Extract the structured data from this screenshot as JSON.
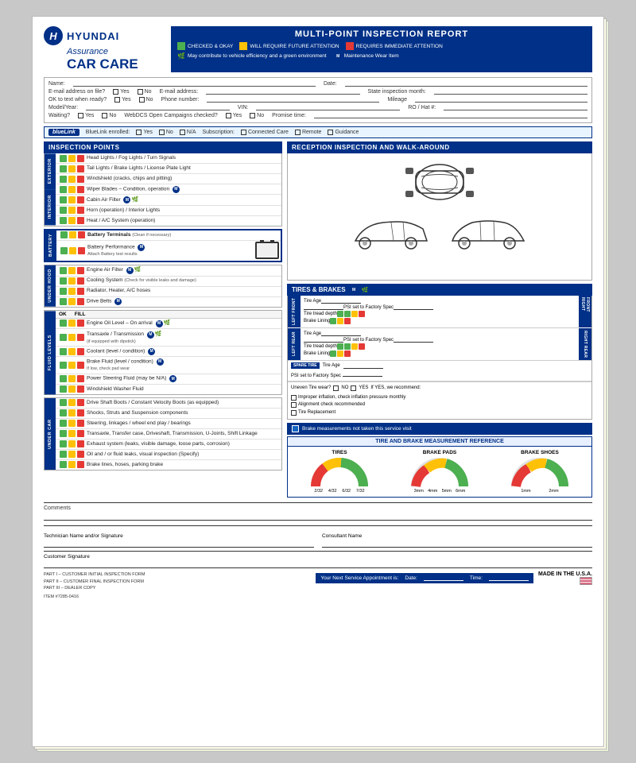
{
  "header": {
    "brand": "HYUNDAI",
    "brand_sub": "Assurance",
    "car_care": "CAR CARE",
    "report_title": "MULTI-POINT INSPECTION REPORT",
    "legend": {
      "checked": "CHECKED & OKAY",
      "will_require": "WILL REQUIRE FUTURE ATTENTION",
      "requires_immediate": "REQUIRES IMMEDIATE ATTENTION",
      "leaf_note": "May contribute to vehicle efficiency and a green environment",
      "mw_note": "Maintenance Wear Item"
    }
  },
  "form_fields": {
    "name_label": "Name:",
    "email_file_label": "E-mail address on file?",
    "ok_text_label": "OK to text when ready?",
    "model_year_label": "Model/Year:",
    "waiting_label": "Waiting?",
    "email_addr_label": "E-mail address:",
    "phone_label": "Phone number:",
    "vin_label": "VIN:",
    "webdcs_label": "WebDCS Open Campaigns checked?",
    "date_label": "Date:",
    "state_insp_label": "State inspection month:",
    "mileage_label": "Mileage",
    "ro_hat_label": "RO / Hat #:",
    "promise_label": "Promise time:"
  },
  "bluelink": {
    "label": "BlueLink",
    "enrolled_label": "BlueLink enrolled:",
    "subscription_label": "Subscription:",
    "connected_care": "Connected Care",
    "remote": "Remote",
    "guidance": "Guidance"
  },
  "inspection": {
    "section_title": "INSPECTION POINTS",
    "groups": {
      "exterior": {
        "label": "EXTERIOR",
        "items": [
          {
            "text": "Head Lights / Fog Lights / Turn Signals",
            "dots": [
              "g",
              "y",
              "r"
            ]
          },
          {
            "text": "Tail Lights / Brake Lights / License Plate Light",
            "dots": [
              "g",
              "y",
              "r"
            ]
          },
          {
            "text": "Windshield (cracks, chips and pitting)",
            "dots": [
              "g",
              "y",
              "r"
            ]
          },
          {
            "text": "Wiper Blades – Condition, operation",
            "dots": [
              "g",
              "y",
              "r"
            ],
            "mw": true
          }
        ]
      },
      "interior": {
        "label": "INTERIOR",
        "items": [
          {
            "text": "Cabin Air Filter",
            "dots": [
              "g",
              "y",
              "r"
            ],
            "leaf": true,
            "mw": true
          },
          {
            "text": "Horn (operation) / Interior Lights",
            "dots": [
              "g",
              "y",
              "r"
            ]
          },
          {
            "text": "Heat / A/C System (operation)",
            "dots": [
              "g",
              "y",
              "r"
            ]
          }
        ]
      },
      "battery": {
        "label": "BATTERY",
        "items": [
          {
            "text": "Battery Terminals",
            "sub": "(Clean if necessary)",
            "dots": [
              "g",
              "y",
              "r"
            ]
          },
          {
            "text": "Battery Performance",
            "dots": [
              "g",
              "y",
              "r"
            ],
            "mw": true,
            "sub": "Attach Battery test results"
          }
        ]
      },
      "under_hood": {
        "label": "UNDER HOOD",
        "items": [
          {
            "text": "Engine Air Filter",
            "dots": [
              "g",
              "y",
              "r"
            ],
            "mw": true,
            "leaf": true
          },
          {
            "text": "Cooling System",
            "sub": "(Check for visible leaks and damage)",
            "dots": [
              "g",
              "y",
              "r"
            ]
          },
          {
            "text": "Radiator, Heater, A/C hoses",
            "dots": [
              "g",
              "y",
              "r"
            ]
          },
          {
            "text": "Drive Belts",
            "dots": [
              "g",
              "y",
              "r"
            ],
            "mw": true
          }
        ]
      },
      "fluid_levels": {
        "label": "FLUID LEVELS",
        "ok_fill": true,
        "items": [
          {
            "text": "Engine Oil Level – On arrival",
            "dots": [
              "g",
              "y",
              "r"
            ],
            "mw": true,
            "leaf": true
          },
          {
            "text": "Transaxle / Transmission",
            "dots": [
              "g",
              "y",
              "r"
            ],
            "mw": true,
            "leaf": true,
            "sub": "(if equipped with dipstick)"
          },
          {
            "text": "Coolant (level / condition)",
            "dots": [
              "g",
              "y",
              "r"
            ],
            "mw": true
          },
          {
            "text": "Brake Fluid (level / condition)",
            "dots": [
              "g",
              "y",
              "r"
            ],
            "mw": true,
            "sub2": "If low, check pad wear"
          },
          {
            "text": "Power Steering Fluid (may be N/A)",
            "dots": [
              "g",
              "y",
              "r"
            ],
            "mw": true
          },
          {
            "text": "Windshield Washer Fluid",
            "dots": [
              "g",
              "y",
              "r"
            ]
          }
        ]
      },
      "under_car": {
        "label": "UNDER CAR",
        "items": [
          {
            "text": "Drive Shaft Boots / Constant Velocity Boots (as equipped)",
            "dots": [
              "g",
              "y",
              "r"
            ]
          },
          {
            "text": "Shocks, Struts and Suspension components",
            "dots": [
              "g",
              "y",
              "r"
            ]
          },
          {
            "text": "Steering, linkages / wheel end play / bearings",
            "dots": [
              "g",
              "y",
              "r"
            ]
          },
          {
            "text": "Transaxle, Transfer case, Driveshaft, Transmission, U-Joints, Shift Linkage",
            "dots": [
              "g",
              "y",
              "r"
            ]
          },
          {
            "text": "Exhaust system (leaks, visible damage, loose parts, corrosion)",
            "dots": [
              "g",
              "y",
              "r"
            ]
          },
          {
            "text": "Oil and / or fluid leaks, visual inspection (Specify)",
            "dots": [
              "g",
              "y",
              "r"
            ]
          },
          {
            "text": "Brake lines, hoses, parking brake",
            "dots": [
              "g",
              "y",
              "r"
            ]
          }
        ]
      }
    }
  },
  "reception": {
    "title": "RECEPTION INSPECTION AND WALK-AROUND"
  },
  "tires_brakes": {
    "title": "TIRES & BRAKES",
    "tire_age_label": "Tire Age",
    "psi_label": "PSI set to Factory Spec",
    "tread_depth_label": "Tire tread depth",
    "brake_lining_label": "Brake Lining",
    "left_front_label": "LEFT FRONT",
    "left_rear_label": "LEFT REAR",
    "right_front_label": "RIGHT FRONT",
    "right_rear_label": "RIGHT REAR",
    "spare_label": "SPARE TIRE",
    "spare_tire_age": "Tire Age",
    "spare_psi": "PSI set to Factory Spec",
    "uneven_label": "Uneven Tire wear?",
    "if_yes": "If YES, we recommend:",
    "improper_infl": "Improper inflation, check inflation pressure monthly",
    "alignment": "Alignment check recommended",
    "tire_replace": "Tire Replacement",
    "brake_notice": "Brake measurements not taken this service visit",
    "ref_title": "TIRE AND BRAKE MEASUREMENT REFERENCE",
    "ref_tires": "TIRES",
    "ref_brake_pads": "BRAKE PADS",
    "ref_brake_shoes": "BRAKE SHOES"
  },
  "comments": {
    "label": "Comments"
  },
  "signatures": {
    "tech_label": "Technician Name and/or Signature",
    "consultant_label": "Consultant Name"
  },
  "customer_sig": {
    "label": "Customer Signature"
  },
  "footer": {
    "part1": "PART I – CUSTOMER INITIAL INSPECTION FORM",
    "part2": "PART II – CUSTOMER FINAL INSPECTION FORM",
    "part3": "PART III – DEALER COPY",
    "item_number": "ITEM #7285-0416",
    "appointment_label": "Your Next Service Appointment is:",
    "date_label": "Date:",
    "time_label": "Time:",
    "made_usa": "MADE IN THE U.S.A."
  }
}
